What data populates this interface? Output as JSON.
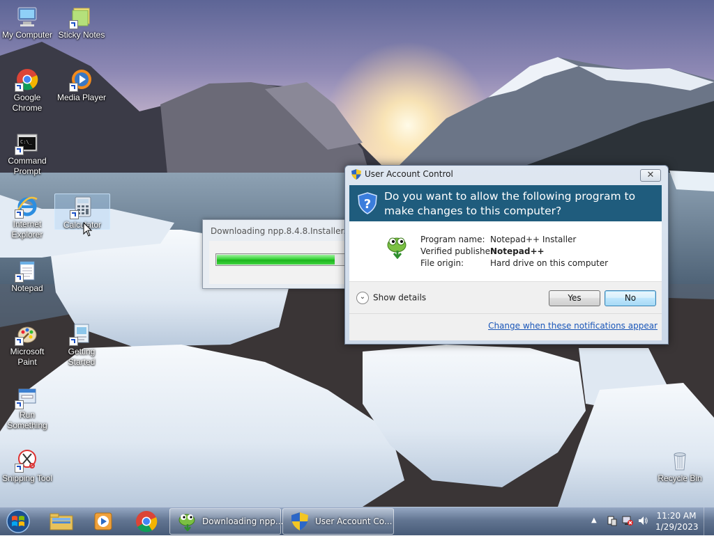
{
  "desktop": {
    "icons": [
      {
        "label": "My Computer",
        "icon": "computer-icon"
      },
      {
        "label": "Sticky Notes",
        "icon": "sticky-notes-icon"
      },
      {
        "label": "Google Chrome",
        "icon": "chrome-icon"
      },
      {
        "label": "Media Player",
        "icon": "media-player-icon"
      },
      {
        "label": "Command Prompt",
        "icon": "command-prompt-icon"
      },
      {
        "label": "Internet Explorer",
        "icon": "internet-explorer-icon"
      },
      {
        "label": "Calculator",
        "icon": "calculator-icon",
        "selected": true
      },
      {
        "label": "Notepad",
        "icon": "notepad-icon"
      },
      {
        "label": "Microsoft Paint",
        "icon": "paint-icon"
      },
      {
        "label": "Getting Started",
        "icon": "getting-started-icon"
      },
      {
        "label": "Run Something",
        "icon": "run-icon"
      },
      {
        "label": "Snipping Tool",
        "icon": "snipping-tool-icon"
      },
      {
        "label": "Recycle Bin",
        "icon": "recycle-bin-icon"
      }
    ]
  },
  "download_window": {
    "title": "Downloading npp.8.4.8.Installer.exe",
    "progress_fraction": 0.9
  },
  "uac": {
    "title": "User Account Control",
    "close_label": "✕",
    "question": "Do you want to allow the following program to make changes to this computer?",
    "fields": [
      {
        "label": "Program name:",
        "value": "Notepad++ Installer",
        "bold": false
      },
      {
        "label": "Verified publisher:",
        "value": "Notepad++",
        "bold": true
      },
      {
        "label": "File origin:",
        "value": "Hard drive on this computer",
        "bold": false
      }
    ],
    "show_details": "Show details",
    "yes": "Yes",
    "no": "No",
    "change_link": "Change when these notifications appear",
    "header_color": "#1f5c7d"
  },
  "taskbar": {
    "tasks": [
      {
        "label": "Downloading npp...",
        "icon": "notepadpp-icon"
      },
      {
        "label": "User Account Co...",
        "icon": "uac-shield-icon"
      }
    ],
    "clock": {
      "time": "11:20 AM",
      "date": "1/29/2023"
    }
  }
}
